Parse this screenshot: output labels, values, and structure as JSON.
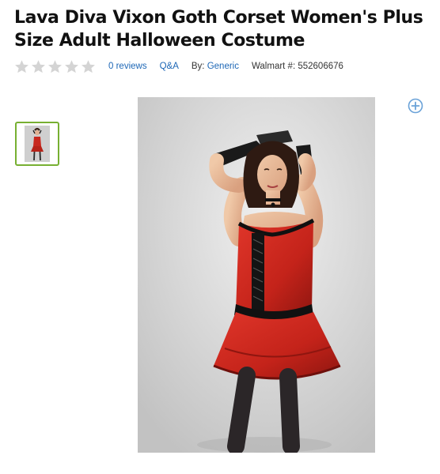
{
  "product": {
    "title": "Lava Diva Vixon Goth Corset Women's Plus Size Adult Halloween Costume",
    "rating_stars": 0,
    "rating_max": 5,
    "reviews_label": "0 reviews",
    "qa_label": "Q&A",
    "by_prefix": "By:",
    "brand": "Generic",
    "walmart_number_label": "Walmart #: 552606676"
  },
  "gallery": {
    "thumbnail_count": 1,
    "selected_index": 0,
    "zoom_icon": "zoom-in-plus-icon"
  },
  "colors": {
    "link": "#1d67b6",
    "thumb_border_selected": "#77b032",
    "star_empty": "#d4d4d4",
    "zoom_icon": "#6aa2d8",
    "dress_red": "#c8281e"
  }
}
